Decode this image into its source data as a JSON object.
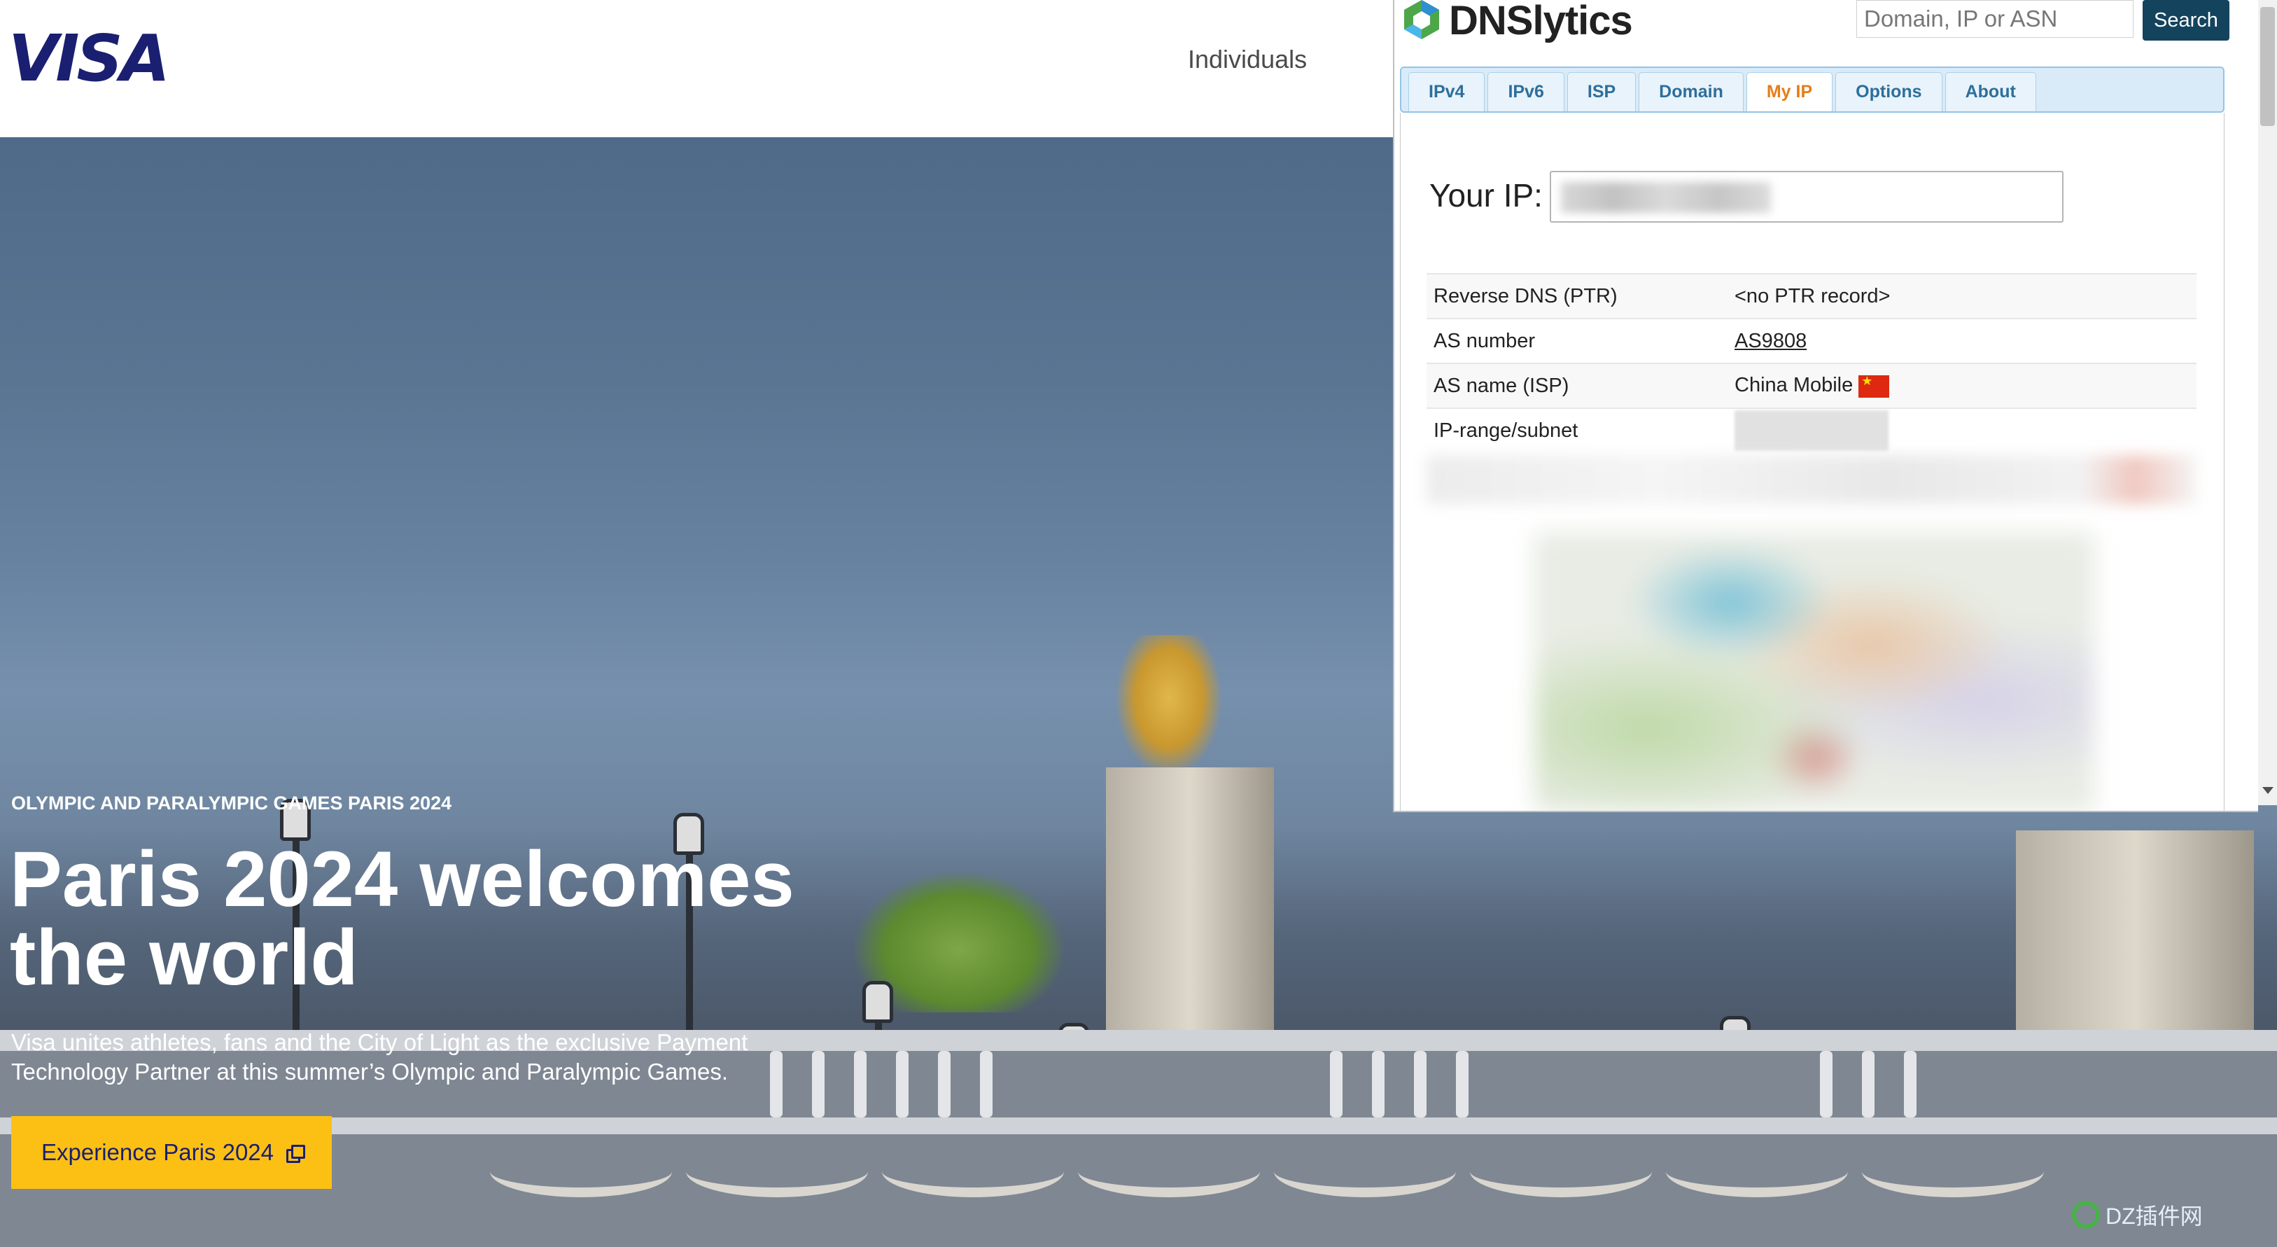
{
  "visa": {
    "logo_text": "VISA",
    "nav": {
      "individuals": "Individuals"
    },
    "hero": {
      "eyebrow": "OLYMPIC AND PARALYMPIC GAMES PARIS 2024",
      "title": "Paris 2024 welcomes the world",
      "description": "Visa unites athletes, fans and the City of Light as the exclusive Payment Technology Partner at this summer’s Olympic and Paralympic Games.",
      "cta_label": "Experience Paris 2024",
      "cta_icon": "external-link-icon"
    }
  },
  "dnslytics": {
    "logo_text": "DNSlytics",
    "search": {
      "placeholder": "Domain, IP or ASN",
      "button_label": "Search"
    },
    "tabs": [
      {
        "label": "IPv4"
      },
      {
        "label": "IPv6"
      },
      {
        "label": "ISP"
      },
      {
        "label": "Domain"
      },
      {
        "label": "My IP"
      },
      {
        "label": "Options"
      },
      {
        "label": "About"
      }
    ],
    "active_tab": "My IP",
    "your_ip_label": "Your IP:",
    "rows": [
      {
        "key": "Reverse DNS (PTR)",
        "value": "<no PTR record>"
      },
      {
        "key": "AS number",
        "value": "AS9808"
      },
      {
        "key": "AS name (ISP)",
        "value": "China Mobile",
        "icon": "china-flag-icon"
      },
      {
        "key": "IP-range/subnet",
        "value": ""
      }
    ]
  },
  "watermark": {
    "text": "DZ插件网"
  },
  "colors": {
    "visa_blue": "#1a1f71",
    "cta_yellow": "#fcc015",
    "dns_search_button": "#14435d",
    "active_tab": "#e57d18",
    "tab_text": "#2d6f9b"
  }
}
